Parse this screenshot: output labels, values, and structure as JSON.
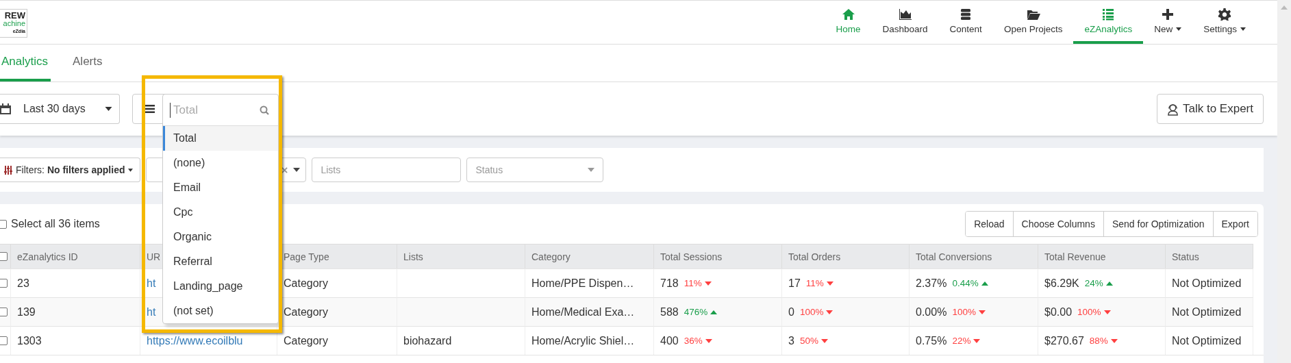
{
  "logo": {
    "line_1": "REW",
    "line_2": "achine",
    "line_3": "eZdia"
  },
  "nav": [
    {
      "label": "Home",
      "kind": "home",
      "selected": false,
      "hover": true
    },
    {
      "label": "Dashboard",
      "kind": "chart",
      "selected": false,
      "hover": false
    },
    {
      "label": "Content",
      "kind": "stack",
      "selected": false,
      "hover": false
    },
    {
      "label": "Open Projects",
      "kind": "folder",
      "selected": false,
      "hover": false
    },
    {
      "label": "eZAnalytics",
      "kind": "list",
      "selected": true,
      "hover": false
    },
    {
      "label": "New",
      "kind": "plus",
      "selected": false,
      "hover": false,
      "caret": true
    },
    {
      "label": "Settings",
      "kind": "gear",
      "selected": false,
      "hover": false,
      "caret": true
    }
  ],
  "tabs": [
    {
      "label": "Analytics",
      "selected": true
    },
    {
      "label": "Alerts",
      "selected": false
    }
  ],
  "date_range": {
    "value": "Last 30 days"
  },
  "talk_button": {
    "label": "Talk to Expert"
  },
  "filters": {
    "label": "Filters: **No filters applied**"
  },
  "lists_field": {
    "placeholder": "Lists"
  },
  "status_field": {
    "placeholder": "Status"
  },
  "select_all": {
    "label": "Select all 36 items",
    "checked": false
  },
  "actions": [
    "Reload",
    "Choose Columns",
    "Send for Optimization",
    "Export"
  ],
  "table": {
    "header_checkbox": {
      "checked": false
    },
    "columns": [
      "eZanalytics ID",
      "UR",
      "Page Type",
      "Lists",
      "Category",
      "Total Sessions",
      "Total Orders",
      "Total Conversions",
      "Total Revenue",
      "Status"
    ],
    "rows": [
      {
        "checked": false,
        "cells": [
          {
            "kind": "text",
            "text": "23"
          },
          {
            "kind": "link",
            "text": "ht"
          },
          {
            "kind": "text",
            "text": "Category"
          },
          {
            "kind": "text",
            "text": ""
          },
          {
            "kind": "text",
            "text": "Home/PPE Dispen…"
          },
          {
            "kind": "fall",
            "value": "718",
            "change": "11%"
          },
          {
            "kind": "fall",
            "value": "17",
            "change": "11%"
          },
          {
            "kind": "rise",
            "value": "2.37%",
            "change": "0.44%"
          },
          {
            "kind": "rise",
            "value": "$6.29K",
            "change": "24%"
          },
          {
            "kind": "text",
            "text": "Not Optimized"
          }
        ]
      },
      {
        "checked": false,
        "cells": [
          {
            "kind": "text",
            "text": "139"
          },
          {
            "kind": "link",
            "text": "ht"
          },
          {
            "kind": "text",
            "text": "Category"
          },
          {
            "kind": "text",
            "text": ""
          },
          {
            "kind": "text",
            "text": "Home/Medical Exa…"
          },
          {
            "kind": "rise",
            "value": "588",
            "change": "476%"
          },
          {
            "kind": "fall",
            "value": "0",
            "change": "100%"
          },
          {
            "kind": "fall",
            "value": "0.00%",
            "change": "100%"
          },
          {
            "kind": "fall",
            "value": "$0.00",
            "change": "100%"
          },
          {
            "kind": "text",
            "text": "Not Optimized"
          }
        ]
      },
      {
        "checked": false,
        "cells": [
          {
            "kind": "text",
            "text": "1303"
          },
          {
            "kind": "link",
            "text": "https://www.ecoilblu"
          },
          {
            "kind": "text",
            "text": "Category"
          },
          {
            "kind": "text",
            "text": "biohazard"
          },
          {
            "kind": "text",
            "text": "Home/Acrylic Shiel…"
          },
          {
            "kind": "fall",
            "value": "400",
            "change": "36%"
          },
          {
            "kind": "fall",
            "value": "3",
            "change": "50%"
          },
          {
            "kind": "fall",
            "value": "0.75%",
            "change": "22%"
          },
          {
            "kind": "fall",
            "value": "$270.67",
            "change": "88%"
          },
          {
            "kind": "text",
            "text": "Not Optimized"
          }
        ]
      }
    ]
  },
  "dropdown": {
    "search_placeholder": "Total",
    "items": [
      {
        "label": "Total",
        "selected": true
      },
      {
        "label": "(none)",
        "selected": false
      },
      {
        "label": "Email",
        "selected": false
      },
      {
        "label": "Cpc",
        "selected": false
      },
      {
        "label": "Organic",
        "selected": false
      },
      {
        "label": "Referral",
        "selected": false
      },
      {
        "label": "Landing_page",
        "selected": false
      },
      {
        "label": "(not set)",
        "selected": false
      }
    ]
  }
}
